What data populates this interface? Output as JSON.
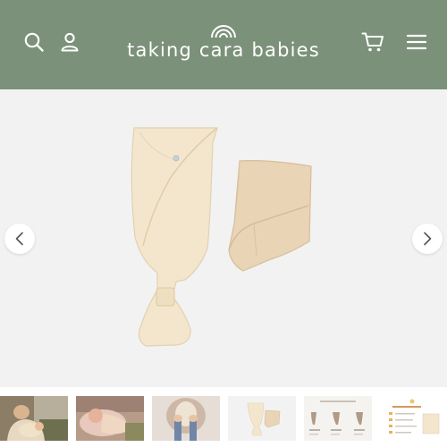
{
  "header": {
    "brand_name": "taking cara babies",
    "icons": [
      "search-icon",
      "user-icon",
      "cart-icon",
      "menu-icon"
    ],
    "background_color": "#7b9179"
  },
  "gallery": {
    "background_color": "#f2f2f2",
    "prev_icon": "chevron-left-icon",
    "next_icon": "chevron-right-icon",
    "product_color": "#f3e6cd"
  },
  "thumbnails": {
    "items": [
      {
        "name": "parent-holding-baby-photo"
      },
      {
        "name": "baby-swaddled-on-pillow-photo"
      },
      {
        "name": "feet-and-swaddle-photo"
      },
      {
        "name": "swaddle-and-band-product-photo"
      },
      {
        "name": "swaddle-steps-infographic"
      },
      {
        "name": "included-items-checklist"
      }
    ]
  }
}
